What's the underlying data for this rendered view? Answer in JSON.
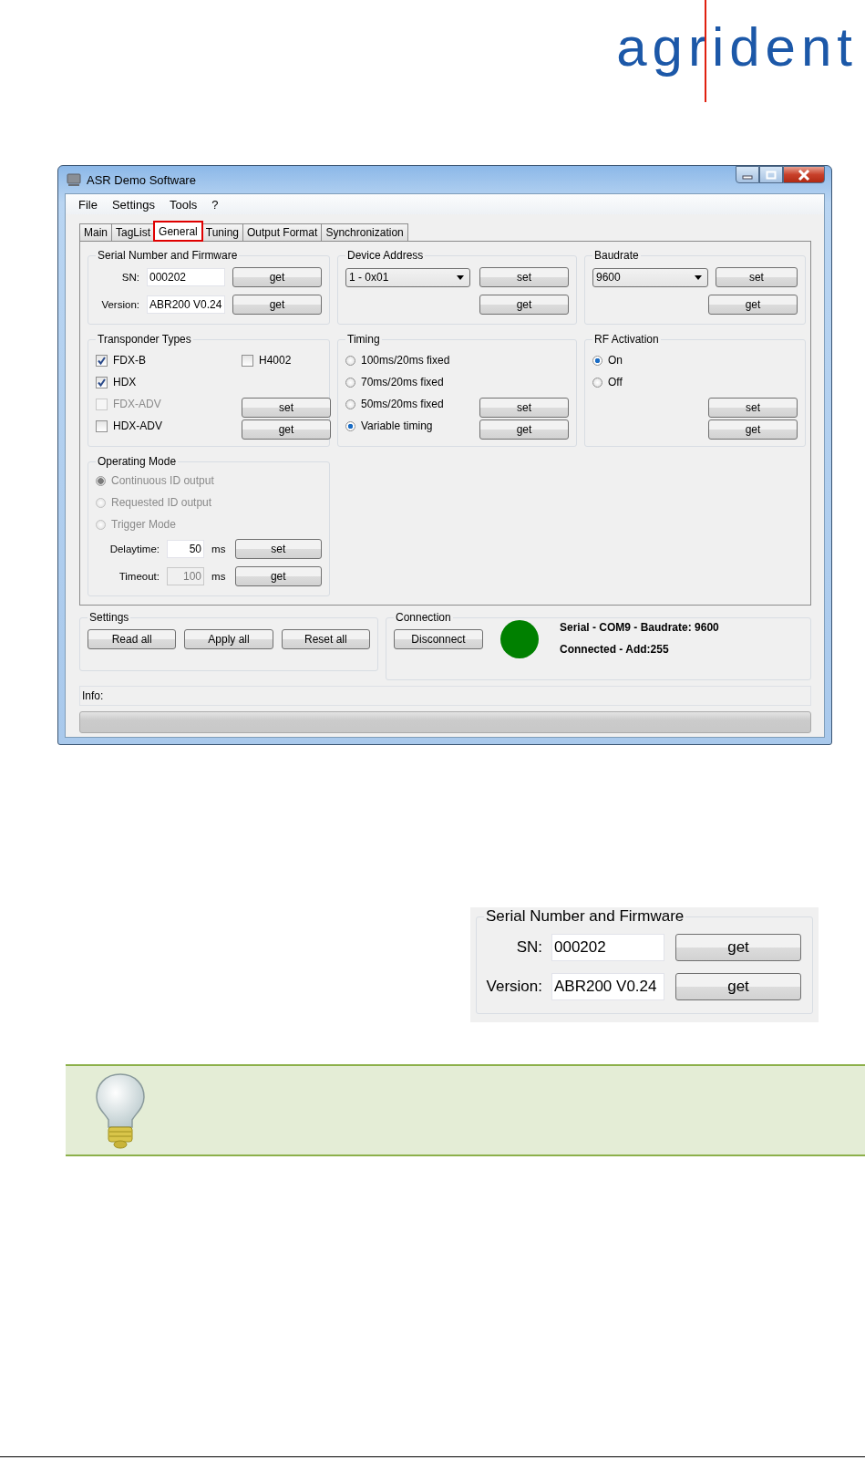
{
  "logo": {
    "text": "agrident"
  },
  "window": {
    "title": "ASR Demo Software"
  },
  "menu": [
    "File",
    "Settings",
    "Tools",
    "?"
  ],
  "tabs": [
    {
      "label": "Main",
      "selected": false,
      "marked": false
    },
    {
      "label": "TagList",
      "selected": false,
      "marked": false
    },
    {
      "label": "General",
      "selected": true,
      "marked": true
    },
    {
      "label": "Tuning",
      "selected": false,
      "marked": false
    },
    {
      "label": "Output Format",
      "selected": false,
      "marked": false
    },
    {
      "label": "Synchronization",
      "selected": false,
      "marked": false
    }
  ],
  "serial": {
    "title": "Serial Number and Firmware",
    "fields": [
      {
        "label": "SN:",
        "value": "000202",
        "button": "get"
      },
      {
        "label": "Version:",
        "value": "ABR200 V0.24",
        "button": "get"
      }
    ]
  },
  "device_address": {
    "title": "Device Address",
    "dropdown": "1 - 0x01",
    "buttons": [
      "set",
      "get"
    ]
  },
  "baudrate": {
    "title": "Baudrate",
    "dropdown": "9600",
    "buttons": [
      "set",
      "get"
    ]
  },
  "transponder_types": {
    "title": "Transponder Types",
    "options": [
      {
        "label": "FDX-B",
        "checked": true,
        "disabled": false
      },
      {
        "label": "H4002",
        "checked": false,
        "disabled": false
      },
      {
        "label": "HDX",
        "checked": true,
        "disabled": false
      },
      {
        "label": "FDX-ADV",
        "checked": false,
        "disabled": true
      },
      {
        "label": "HDX-ADV",
        "checked": false,
        "disabled": false
      }
    ],
    "buttons": [
      "set",
      "get"
    ]
  },
  "timing": {
    "title": "Timing",
    "options": [
      {
        "label": "100ms/20ms fixed",
        "selected": false
      },
      {
        "label": "70ms/20ms fixed",
        "selected": false
      },
      {
        "label": "50ms/20ms fixed",
        "selected": false
      },
      {
        "label": "Variable timing",
        "selected": true
      }
    ],
    "buttons": [
      "set",
      "get"
    ]
  },
  "rf_activation": {
    "title": "RF Activation",
    "options": [
      {
        "label": "On",
        "selected": true
      },
      {
        "label": "Off",
        "selected": false
      }
    ],
    "buttons": [
      "set",
      "get"
    ]
  },
  "operating_mode": {
    "title": "Operating Mode",
    "options": [
      {
        "label": "Continuous ID output",
        "selected": true,
        "disabled": true
      },
      {
        "label": "Requested ID output",
        "selected": false,
        "disabled": true
      },
      {
        "label": "Trigger Mode",
        "selected": false,
        "disabled": true
      }
    ],
    "fields": [
      {
        "label": "Delaytime:",
        "value": "50",
        "unit": "ms",
        "button": "set",
        "disabled": false
      },
      {
        "label": "Timeout:",
        "value": "100",
        "unit": "ms",
        "button": "get",
        "disabled": true
      }
    ]
  },
  "settings": {
    "title": "Settings",
    "buttons": [
      "Read all",
      "Apply all",
      "Reset all"
    ]
  },
  "connection": {
    "title": "Connection",
    "button": "Disconnect",
    "color": "#008000",
    "lines": [
      "Serial - COM9 - Baudrate: 9600",
      "Connected - Add:255"
    ]
  },
  "info": {
    "label": "Info:"
  },
  "progress": {
    "level": 0
  },
  "detail": {
    "title": "Serial Number and Firmware",
    "fields": [
      {
        "label": "SN:",
        "value": "000202",
        "button": "get"
      },
      {
        "label": "Version:",
        "value": "ABR200 V0.24",
        "button": "get"
      }
    ]
  }
}
